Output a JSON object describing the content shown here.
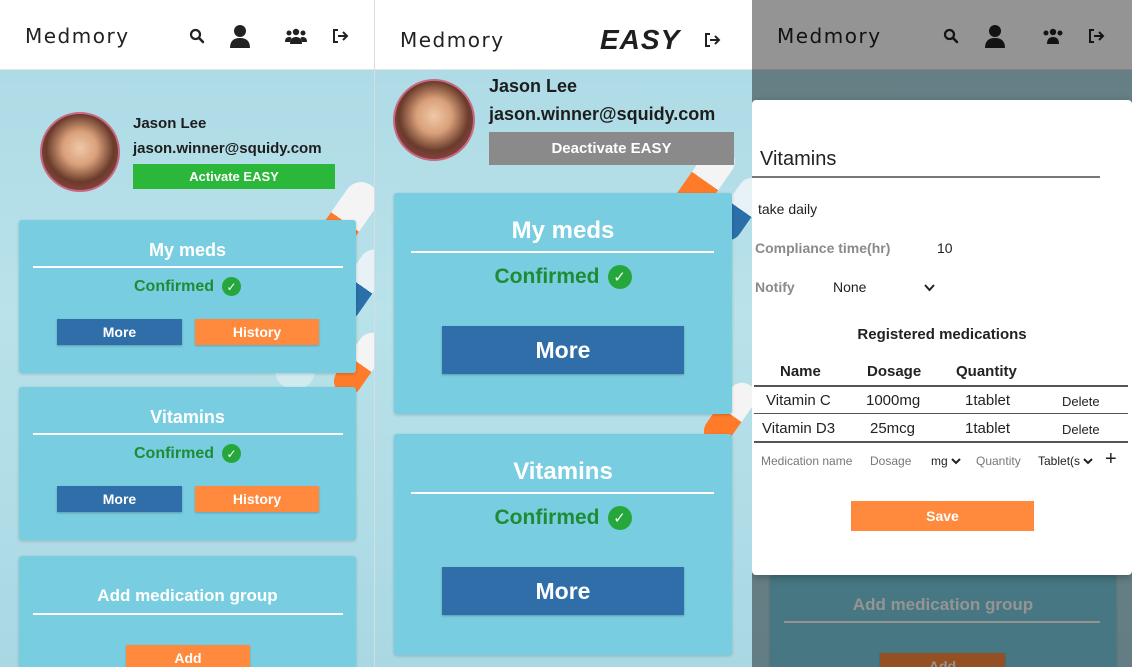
{
  "app": {
    "logo": "Medmory",
    "easy_title": "EASY"
  },
  "user": {
    "name": "Jason Lee",
    "email": "jason.winner@squidy.com"
  },
  "buttons": {
    "activate_easy": "Activate EASY",
    "deactivate_easy": "Deactivate EASY",
    "more": "More",
    "history": "History",
    "add": "Add",
    "save": "Save"
  },
  "cards": {
    "my_meds": {
      "title": "My meds",
      "status": "Confirmed"
    },
    "vitamins": {
      "title": "Vitamins",
      "status": "Confirmed"
    },
    "add_group": {
      "title": "Add medication group"
    }
  },
  "modal": {
    "title": "Vitamins",
    "note": "take daily",
    "compliance_label": "Compliance time(hr)",
    "compliance_value": "10",
    "notify_label": "Notify",
    "notify_value": "None",
    "section_title": "Registered medications",
    "columns": [
      "Name",
      "Dosage",
      "Quantity"
    ],
    "rows": [
      {
        "name": "Vitamin C",
        "dosage": "1000mg",
        "quantity": "1tablet",
        "action": "Delete"
      },
      {
        "name": "Vitamin D3",
        "dosage": "25mcg",
        "quantity": "1tablet",
        "action": "Delete"
      }
    ],
    "new_row": {
      "name_placeholder": "Medication name",
      "dosage_placeholder": "Dosage",
      "unit_value": "mg",
      "quantity_placeholder": "Quantity",
      "form_value": "Tablet(s"
    }
  },
  "colors": {
    "card": "#79cde0",
    "confirmed": "#1e8c35",
    "blue_button": "#2f6ea8",
    "orange_button": "#ff8a3d",
    "green_button": "#2bb83a"
  }
}
